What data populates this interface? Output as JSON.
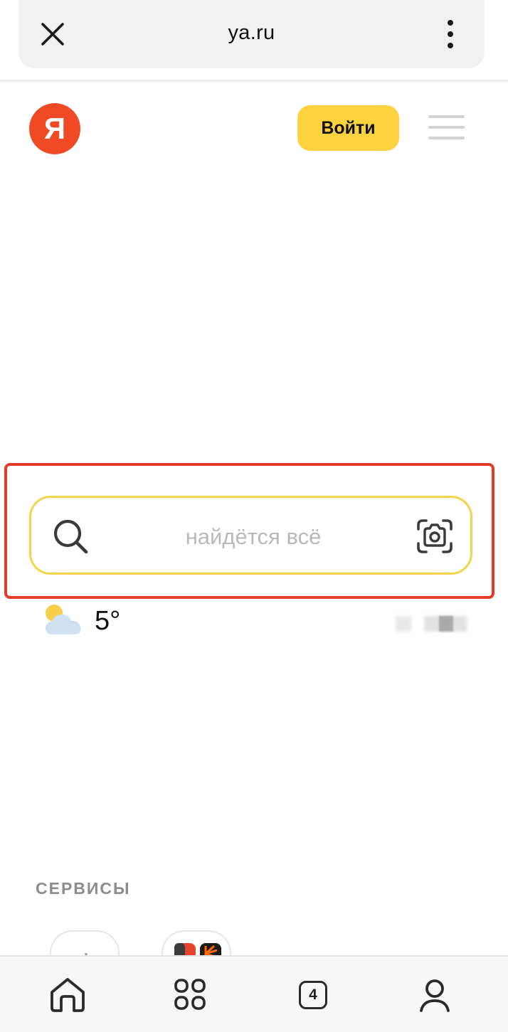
{
  "browser": {
    "url": "ya.ru"
  },
  "header": {
    "logo_letter": "Я",
    "login_label": "Войти"
  },
  "search": {
    "placeholder": "найдётся всё",
    "value": ""
  },
  "weather": {
    "temperature": "5°"
  },
  "services": {
    "heading": "СЕРВИСЫ"
  },
  "bottom_nav": {
    "tabs_count": "4"
  },
  "colors": {
    "brand_red": "#f04a25",
    "login_yellow": "#fcd23f",
    "search_border": "#f2d34a",
    "highlight_red": "#e43b27"
  }
}
